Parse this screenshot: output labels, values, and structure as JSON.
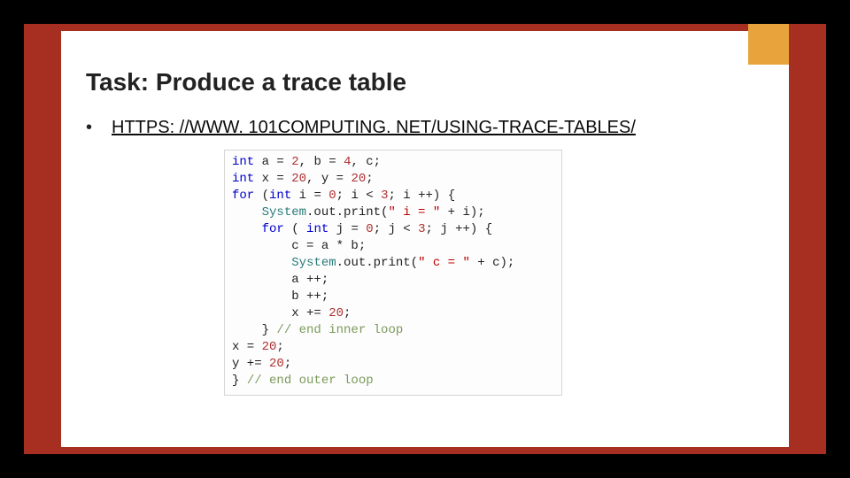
{
  "title": "Task: Produce a trace table",
  "bullet_link": "HTTPS: //WWW. 101COMPUTING. NET/USING-TRACE-TABLES/",
  "bullet_marker": "•",
  "code_tokens": [
    [
      [
        "kw",
        "int"
      ],
      [
        "p",
        " a "
      ],
      [
        "op",
        "= "
      ],
      [
        "num",
        "2"
      ],
      [
        "op",
        ", "
      ],
      [
        "p",
        "b "
      ],
      [
        "op",
        "= "
      ],
      [
        "num",
        "4"
      ],
      [
        "op",
        ", "
      ],
      [
        "p",
        "c"
      ],
      [
        "op",
        ";"
      ]
    ],
    [
      [
        "kw",
        "int"
      ],
      [
        "p",
        " x "
      ],
      [
        "op",
        "= "
      ],
      [
        "num",
        "20"
      ],
      [
        "op",
        ", "
      ],
      [
        "p",
        "y "
      ],
      [
        "op",
        "= "
      ],
      [
        "num",
        "20"
      ],
      [
        "op",
        ";"
      ]
    ],
    [
      [
        "kw",
        "for"
      ],
      [
        "p",
        " ("
      ],
      [
        "kw",
        "int"
      ],
      [
        "p",
        " i "
      ],
      [
        "op",
        "= "
      ],
      [
        "num",
        "0"
      ],
      [
        "op",
        "; "
      ],
      [
        "p",
        "i "
      ],
      [
        "op",
        "< "
      ],
      [
        "num",
        "3"
      ],
      [
        "op",
        "; "
      ],
      [
        "p",
        "i "
      ],
      [
        "op",
        "++"
      ],
      [
        "p",
        ") {"
      ]
    ],
    [
      [
        "p",
        "    "
      ],
      [
        "id",
        "System"
      ],
      [
        "op",
        "."
      ],
      [
        "p",
        "out"
      ],
      [
        "op",
        "."
      ],
      [
        "p",
        "print"
      ],
      [
        "p",
        "("
      ],
      [
        "str",
        "\" i = \""
      ],
      [
        "p",
        " "
      ],
      [
        "op",
        "+"
      ],
      [
        "p",
        " i);"
      ]
    ],
    [
      [
        "p",
        "    "
      ],
      [
        "kw",
        "for"
      ],
      [
        "p",
        " ( "
      ],
      [
        "kw",
        "int"
      ],
      [
        "p",
        " j "
      ],
      [
        "op",
        "= "
      ],
      [
        "num",
        "0"
      ],
      [
        "op",
        "; "
      ],
      [
        "p",
        "j "
      ],
      [
        "op",
        "< "
      ],
      [
        "num",
        "3"
      ],
      [
        "op",
        "; "
      ],
      [
        "p",
        "j "
      ],
      [
        "op",
        "++"
      ],
      [
        "p",
        ") {"
      ]
    ],
    [
      [
        "p",
        "        c "
      ],
      [
        "op",
        "="
      ],
      [
        "p",
        " a "
      ],
      [
        "op",
        "*"
      ],
      [
        "p",
        " b"
      ],
      [
        "op",
        ";"
      ]
    ],
    [
      [
        "p",
        "        "
      ],
      [
        "id",
        "System"
      ],
      [
        "op",
        "."
      ],
      [
        "p",
        "out"
      ],
      [
        "op",
        "."
      ],
      [
        "p",
        "print"
      ],
      [
        "p",
        "("
      ],
      [
        "str",
        "\" c = \""
      ],
      [
        "p",
        " "
      ],
      [
        "op",
        "+"
      ],
      [
        "p",
        " c);"
      ]
    ],
    [
      [
        "p",
        "        a "
      ],
      [
        "op",
        "++"
      ],
      [
        "op",
        ";"
      ]
    ],
    [
      [
        "p",
        "        b "
      ],
      [
        "op",
        "++"
      ],
      [
        "op",
        ";"
      ]
    ],
    [
      [
        "p",
        "        x "
      ],
      [
        "op",
        "+="
      ],
      [
        "p",
        " "
      ],
      [
        "num",
        "20"
      ],
      [
        "op",
        ";"
      ]
    ],
    [
      [
        "p",
        "    } "
      ],
      [
        "cm",
        "// end inner loop"
      ]
    ],
    [
      [
        "p",
        "x "
      ],
      [
        "op",
        "="
      ],
      [
        "p",
        " "
      ],
      [
        "num",
        "20"
      ],
      [
        "op",
        ";"
      ]
    ],
    [
      [
        "p",
        "y "
      ],
      [
        "op",
        "+="
      ],
      [
        "p",
        " "
      ],
      [
        "num",
        "20"
      ],
      [
        "op",
        ";"
      ]
    ],
    [
      [
        "p",
        "} "
      ],
      [
        "cm",
        "// end outer loop"
      ]
    ]
  ]
}
